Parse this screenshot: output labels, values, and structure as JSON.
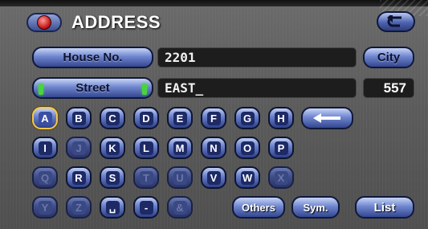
{
  "header": {
    "title": "ADDRESS",
    "icon": "map-pin-icon",
    "back_icon": "return-arrow-icon"
  },
  "house": {
    "button_label": "House No.",
    "value": "2201"
  },
  "city": {
    "button_label": "City"
  },
  "street": {
    "button_label": "Street",
    "value": "EAST_"
  },
  "match_count": "557",
  "keys": {
    "A": "A",
    "B": "B",
    "C": "C",
    "D": "D",
    "E": "E",
    "F": "F",
    "G": "G",
    "H": "H",
    "I": "I",
    "J": "J",
    "K": "K",
    "L": "L",
    "M": "M",
    "N": "N",
    "O": "O",
    "P": "P",
    "Q": "Q",
    "R": "R",
    "S": "S",
    "T": "T",
    "U": "U",
    "V": "V",
    "W": "W",
    "X": "X",
    "Y": "Y",
    "Z": "Z",
    "space": "␣",
    "dash": "-",
    "amp": "&"
  },
  "buttons": {
    "others": "Others",
    "sym": "Sym.",
    "list": "List",
    "backspace_icon": "backspace-arrow-icon"
  },
  "colors": {
    "accent": "#5a6fc0",
    "selected": "#f3c64a",
    "street_indicator": "#49d43f"
  }
}
